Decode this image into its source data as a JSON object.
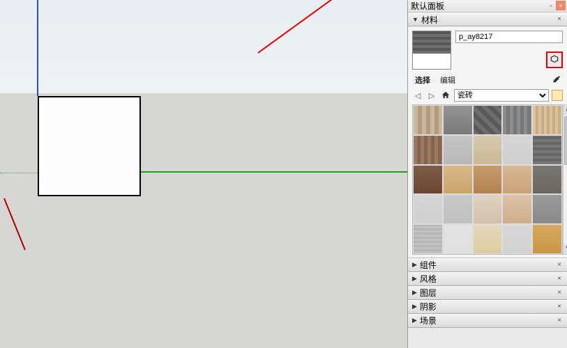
{
  "window": {
    "title": "默认面板"
  },
  "materials": {
    "section_label": "材料",
    "current_name": "p_ay8217",
    "tabs": {
      "select": "选择",
      "edit": "编辑"
    },
    "library_select": "瓷砖",
    "thumbs": [
      {
        "bg": "repeating-linear-gradient(90deg,#cbb79b 0 6px,#b29c7e 6px 12px)"
      },
      {
        "bg": "linear-gradient(#949494,#7a7a7a)"
      },
      {
        "bg": "repeating-linear-gradient(45deg,#6e6e6e 0 6px,#595959 6px 12px)"
      },
      {
        "bg": "repeating-linear-gradient(90deg,#8c8c8c 0 5px,#777 5px 10px)"
      },
      {
        "bg": "repeating-linear-gradient(90deg,#d8c2a0 0 4px,#c6ae88 4px 8px)"
      },
      {
        "bg": "repeating-linear-gradient(90deg,#9a7a66 0 5px,#86644e 5px 10px)"
      },
      {
        "bg": "linear-gradient(#c5c5c5,#b8b8b8)"
      },
      {
        "bg": "linear-gradient(#d6c9ad,#c9b995)"
      },
      {
        "bg": "linear-gradient(#d5d5d5,#cfcfcf)"
      },
      {
        "bg": "repeating-linear-gradient(0deg,#777 0 4px,#666 4px 8px)"
      },
      {
        "bg": "linear-gradient(#7e5a48,#6c4734)"
      },
      {
        "bg": "linear-gradient(#d9b987,#c9a46c)"
      },
      {
        "bg": "linear-gradient(#c79a6a,#b18350)"
      },
      {
        "bg": "linear-gradient(#d9b893,#c9a278)"
      },
      {
        "bg": "linear-gradient(#7a7770,#6a675f)"
      },
      {
        "bg": "linear-gradient(#d5d5d5,#d0d0d0)"
      },
      {
        "bg": "linear-gradient(#c9c9c9,#c0c0c0)"
      },
      {
        "bg": "linear-gradient(#e0d2c2,#d2c0aa)"
      },
      {
        "bg": "linear-gradient(#dcc2a7,#ceae8b)"
      },
      {
        "bg": "linear-gradient(#999,#8a8a8a)"
      },
      {
        "bg": "repeating-linear-gradient(0deg,#c2c2c2 0 3px,#b6b6b6 3px 6px)"
      },
      {
        "bg": "linear-gradient(#e2e2e2,#e0e0e0)"
      },
      {
        "bg": "linear-gradient(#e5d9bc,#dccc9f)"
      },
      {
        "bg": "linear-gradient(#d7d7d7,#d2d2d2)"
      },
      {
        "bg": "linear-gradient(#d6a95e,#c99644)"
      }
    ]
  },
  "collapsed_sections": [
    "组件",
    "风格",
    "图层",
    "阴影",
    "场景"
  ]
}
